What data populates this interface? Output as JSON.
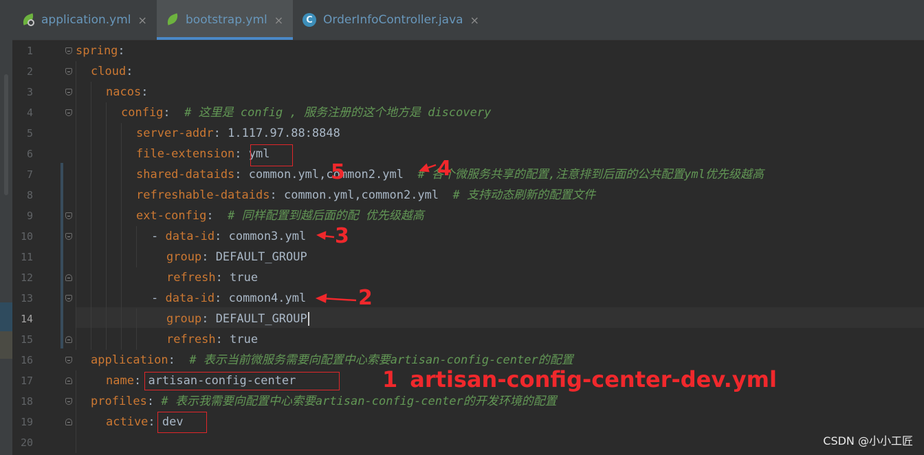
{
  "tabs": [
    {
      "name": "application.yml",
      "icon": "spring-config-icon",
      "active": false
    },
    {
      "name": "bootstrap.yml",
      "icon": "spring-leaf-icon",
      "active": true
    },
    {
      "name": "OrderInfoController.java",
      "icon": "java-class-icon",
      "active": false
    }
  ],
  "tab_close_symbol": "×",
  "java_badge": "C",
  "line_numbers": [
    "1",
    "2",
    "3",
    "4",
    "5",
    "6",
    "7",
    "8",
    "9",
    "10",
    "11",
    "12",
    "13",
    "14",
    "15",
    "16",
    "17",
    "18",
    "19",
    "20"
  ],
  "current_line": "14",
  "code": {
    "l1_key": "spring",
    "l2_key": "cloud",
    "l3_key": "nacos",
    "l4_key": "config",
    "l4_comment": "# 这里是 config , 服务注册的这个地方是 discovery",
    "l5_key": "server-addr",
    "l5_val": "1.117.97.88:8848",
    "l6_key": "file-extension",
    "l6_val": "yml",
    "l7_key": "shared-dataids",
    "l7_val": "common.yml,common2.yml",
    "l7_comment": "# 各个微服务共享的配置,注意排到后面的公共配置yml优先级越高",
    "l8_key": "refreshable-dataids",
    "l8_val": "common.yml,common2.yml",
    "l8_comment": "# 支持动态刷新的配置文件",
    "l9_key": "ext-config",
    "l9_comment": "# 同样配置到越后面的配 优先级越高",
    "l10_dash": "- ",
    "l10_key": "data-id",
    "l10_val": "common3.yml",
    "l11_key": "group",
    "l11_val": "DEFAULT_GROUP",
    "l12_key": "refresh",
    "l12_val": "true",
    "l13_dash": "- ",
    "l13_key": "data-id",
    "l13_val": "common4.yml",
    "l14_key": "group",
    "l14_val": "DEFAULT_GROUP",
    "l15_key": "refresh",
    "l15_val": "true",
    "l16_key": "application",
    "l16_comment": "# 表示当前微服务需要向配置中心索要artisan-config-center的配置",
    "l17_key": "name",
    "l17_val": "artisan-config-center",
    "l18_key": "profiles",
    "l18_comment": "# 表示我需要向配置中心索要artisan-config-center的开发环境的配置",
    "l19_key": "active",
    "l19_val": "dev",
    "colon": ":"
  },
  "annotations": {
    "a1_num": "1",
    "a1_text": "artisan-config-center-dev.yml",
    "a2": "2",
    "a3": "3",
    "a4": "4",
    "a5": "5"
  },
  "watermark": "CSDN @小小工匠",
  "colors": {
    "background": "#2b2b2b",
    "key": "#cc7832",
    "value": "#a9b7c6",
    "comment": "#629755",
    "annotation": "#f0282c",
    "tab_active_underline": "#4a88c7"
  }
}
